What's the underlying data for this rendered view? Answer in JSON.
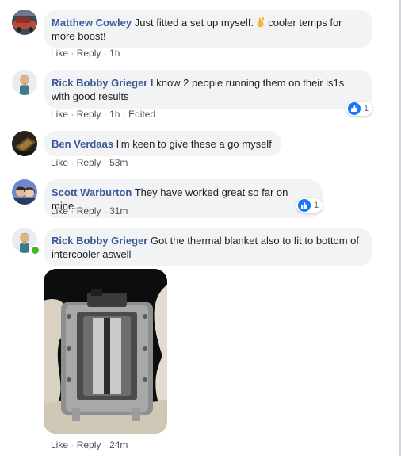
{
  "comments": [
    {
      "author": "Matthew Cowley",
      "text_before": "Just fitted a set up myself.",
      "emoji": "crossed-fingers-emoji",
      "text_after": "cooler temps for more boost!",
      "actions": {
        "like": "Like",
        "reply": "Reply",
        "time": "1h"
      }
    },
    {
      "author": "Rick Bobby Grieger",
      "text": "I know 2 people running them on their ls1s with good results",
      "actions": {
        "like": "Like",
        "reply": "Reply",
        "time": "1h",
        "edited": "Edited"
      },
      "reaction": {
        "icon": "like-icon",
        "count": "1"
      }
    },
    {
      "author": "Ben Verdaas",
      "text": "I'm keen to give these a go myself",
      "actions": {
        "like": "Like",
        "reply": "Reply",
        "time": "53m"
      }
    },
    {
      "author": "Scott Warburton",
      "text": "They have worked great so far on mine.",
      "actions": {
        "like": "Like",
        "reply": "Reply",
        "time": "31m"
      },
      "reaction": {
        "icon": "like-icon",
        "count": "1"
      }
    },
    {
      "author": "Rick Bobby Grieger",
      "text": "Got the thermal blanket also to fit to bottom of intercooler aswell",
      "actions": {
        "like": "Like",
        "reply": "Reply",
        "time": "24m"
      },
      "attachment": "intercooler-photo",
      "online": true
    }
  ],
  "colors": {
    "author": "#385898",
    "bubble": "#f2f3f5",
    "action_text": "#616770",
    "like_badge": "#1877f2",
    "online": "#42b72a"
  }
}
